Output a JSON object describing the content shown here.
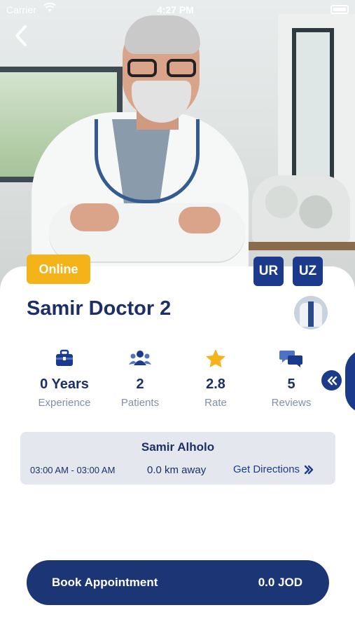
{
  "status_bar": {
    "carrier": "Carrier",
    "time": "4:27 PM"
  },
  "doctor": {
    "status_badge": "Online",
    "languages": [
      "UR",
      "UZ"
    ],
    "name": "Samir Doctor 2"
  },
  "stats": [
    {
      "icon": "briefcase-icon",
      "value": "0 Years",
      "label": "Experience"
    },
    {
      "icon": "patients-icon",
      "value": "2",
      "label": "Patients"
    },
    {
      "icon": "star-icon",
      "value": "2.8",
      "label": "Rate"
    },
    {
      "icon": "chat-bubbles-icon",
      "value": "5",
      "label": "Reviews"
    }
  ],
  "clinic": {
    "name": "Samir Alholo",
    "hours": "03:00 AM - 03:00 AM",
    "distance": "0.0 km away",
    "directions_label": "Get Directions"
  },
  "booking": {
    "label": "Book Appointment",
    "price": "0.0 JOD"
  },
  "colors": {
    "primary": "#1c3a8c",
    "badge": "#f5b31a",
    "text_dark": "#1c2f66",
    "star": "#f5b31a"
  }
}
